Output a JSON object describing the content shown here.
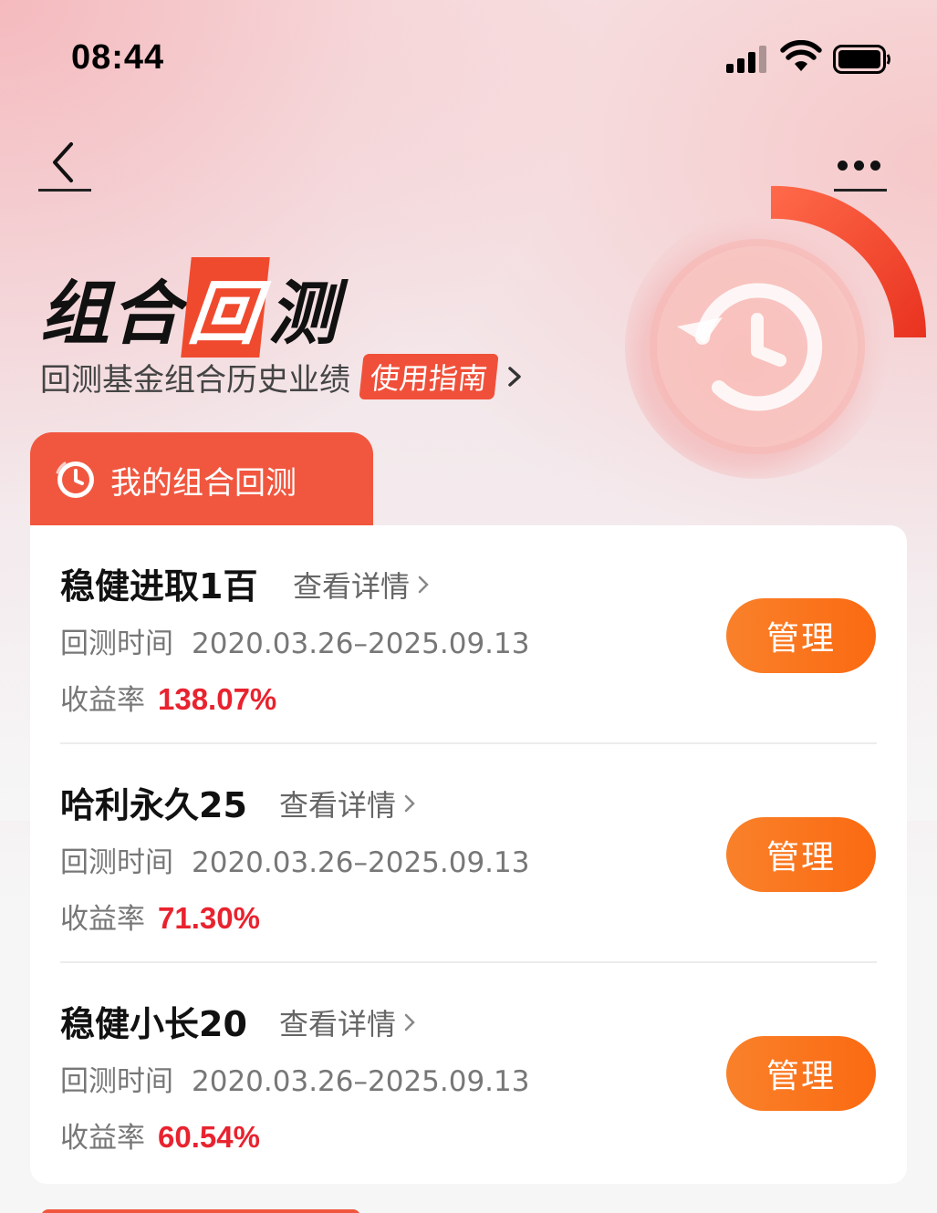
{
  "status_bar": {
    "time": "08:44"
  },
  "hero": {
    "title_a": "组合",
    "title_highlight": "回",
    "title_b": "测",
    "subtitle": "回测基金组合历史业绩",
    "guide_label": "使用指南"
  },
  "tab": {
    "label": "我的组合回测"
  },
  "items": [
    {
      "name": "稳健进取1百",
      "detail_label": "查看详情",
      "period_label": "回测时间",
      "period": "2020.03.26–2025.09.13",
      "return_label": "收益率",
      "return_value": "138.07%",
      "manage_label": "管理"
    },
    {
      "name": "哈利永久25",
      "detail_label": "查看详情",
      "period_label": "回测时间",
      "period": "2020.03.26–2025.09.13",
      "return_label": "收益率",
      "return_value": "71.30%",
      "manage_label": "管理"
    },
    {
      "name": "稳健小长20",
      "detail_label": "查看详情",
      "period_label": "回测时间",
      "period": "2020.03.26–2025.09.13",
      "return_label": "收益率",
      "return_value": "60.54%",
      "manage_label": "管理"
    }
  ],
  "colors": {
    "accent": "#f1573f",
    "return_red": "#e8232f",
    "button_orange": "#fb6a12"
  }
}
